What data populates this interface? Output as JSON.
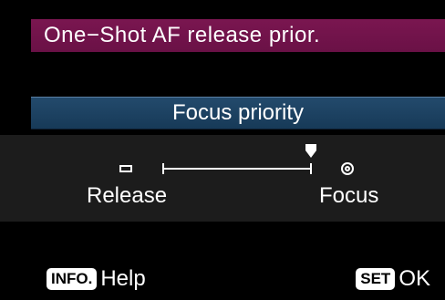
{
  "menu": {
    "title": "One−Shot AF release prior."
  },
  "setting": {
    "current_value": "Focus priority",
    "left_label": "Release",
    "right_label": "Focus",
    "left_icon": "release-square-icon",
    "right_icon": "focus-circle-icon",
    "selected_position": "Focus"
  },
  "footer": {
    "info_key": "INFO.",
    "info_label": "Help",
    "set_key": "SET",
    "set_label": "OK"
  },
  "colors": {
    "title_bar": "#7a1650",
    "value_banner": "#234a6c",
    "background": "#000000",
    "slider_panel": "#1c1c1c"
  }
}
